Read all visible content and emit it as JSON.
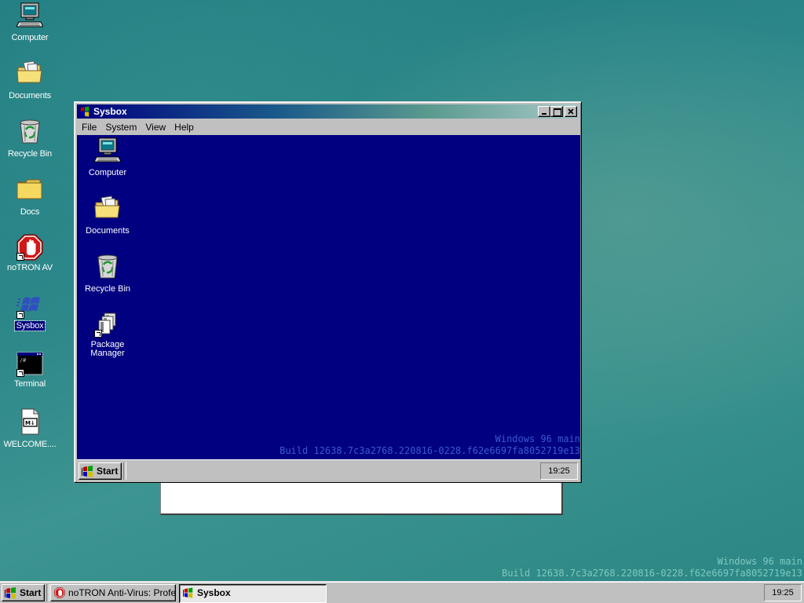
{
  "desktop": {
    "icons": [
      {
        "label": "Computer",
        "icon": "computer-icon"
      },
      {
        "label": "Documents",
        "icon": "documents-folder-icon"
      },
      {
        "label": "Recycle Bin",
        "icon": "recycle-bin-icon"
      },
      {
        "label": "Docs",
        "icon": "folder-icon"
      },
      {
        "label": "noTRON AV",
        "icon": "stop-hand-icon"
      },
      {
        "label": "Sysbox",
        "icon": "windows-logo-icon"
      },
      {
        "label": "Terminal",
        "icon": "terminal-icon"
      },
      {
        "label": "WELCOME....",
        "icon": "markdown-file-icon"
      }
    ],
    "watermark": {
      "line1": "Windows 96 main",
      "line2": "Build 12638.7c3a2768.220816-0228.f62e6697fa8052719e13"
    }
  },
  "sysbox_window": {
    "title": "Sysbox",
    "menu": [
      "File",
      "System",
      "View",
      "Help"
    ],
    "icons": [
      {
        "label": "Computer",
        "icon": "computer-icon"
      },
      {
        "label": "Documents",
        "icon": "documents-folder-icon"
      },
      {
        "label": "Recycle Bin",
        "icon": "recycle-bin-icon"
      },
      {
        "label_line1": "Package",
        "label_line2": "Manager",
        "icon": "package-manager-icon"
      }
    ],
    "watermark": {
      "line1": "Windows 96 main",
      "line2": "Build 12638.7c3a2768.220816-0228.f62e6697fa8052719e13"
    },
    "taskbar": {
      "start_label": "Start",
      "clock": "19:25"
    }
  },
  "taskbar": {
    "start_label": "Start",
    "tasks": [
      {
        "label": "noTRON Anti-Virus: Profes...",
        "icon": "stop-hand-icon",
        "active": false
      },
      {
        "label": "Sysbox",
        "icon": "windows-logo-icon",
        "active": true
      }
    ],
    "clock": "19:25"
  },
  "colors": {
    "desktop": "#2b8689",
    "window_client": "#000080",
    "title_active_start": "#000080",
    "chrome": "#c0c0c0"
  }
}
